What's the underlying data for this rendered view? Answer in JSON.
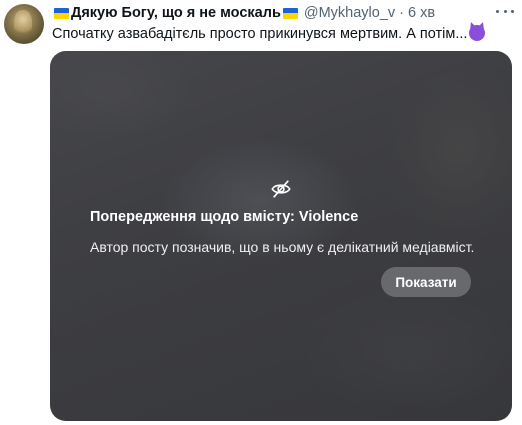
{
  "tweet": {
    "display_name": "Дякую Богу, що я не москаль",
    "handle": "@Mykhaylo_v",
    "separator": "·",
    "time": "6 хв",
    "text": "Спочатку азвабадітєль просто прикинувся мертвим. А потім...",
    "text_emoji_icon": "smiling-devil-icon",
    "name_flag_icon": "ukraine-flag-icon"
  },
  "media": {
    "warning_title": "Попередження щодо вмісту: Violence",
    "warning_description": "Автор посту позначив, що в ньому є делікатний медіавміст.",
    "show_button_label": "Показати",
    "hidden_icon": "eye-slash-icon"
  },
  "colors": {
    "flag_blue": "#1e63d6",
    "flag_yellow": "#ffd500",
    "secondary_text": "#536471",
    "media_bg": "#4b4c51"
  }
}
